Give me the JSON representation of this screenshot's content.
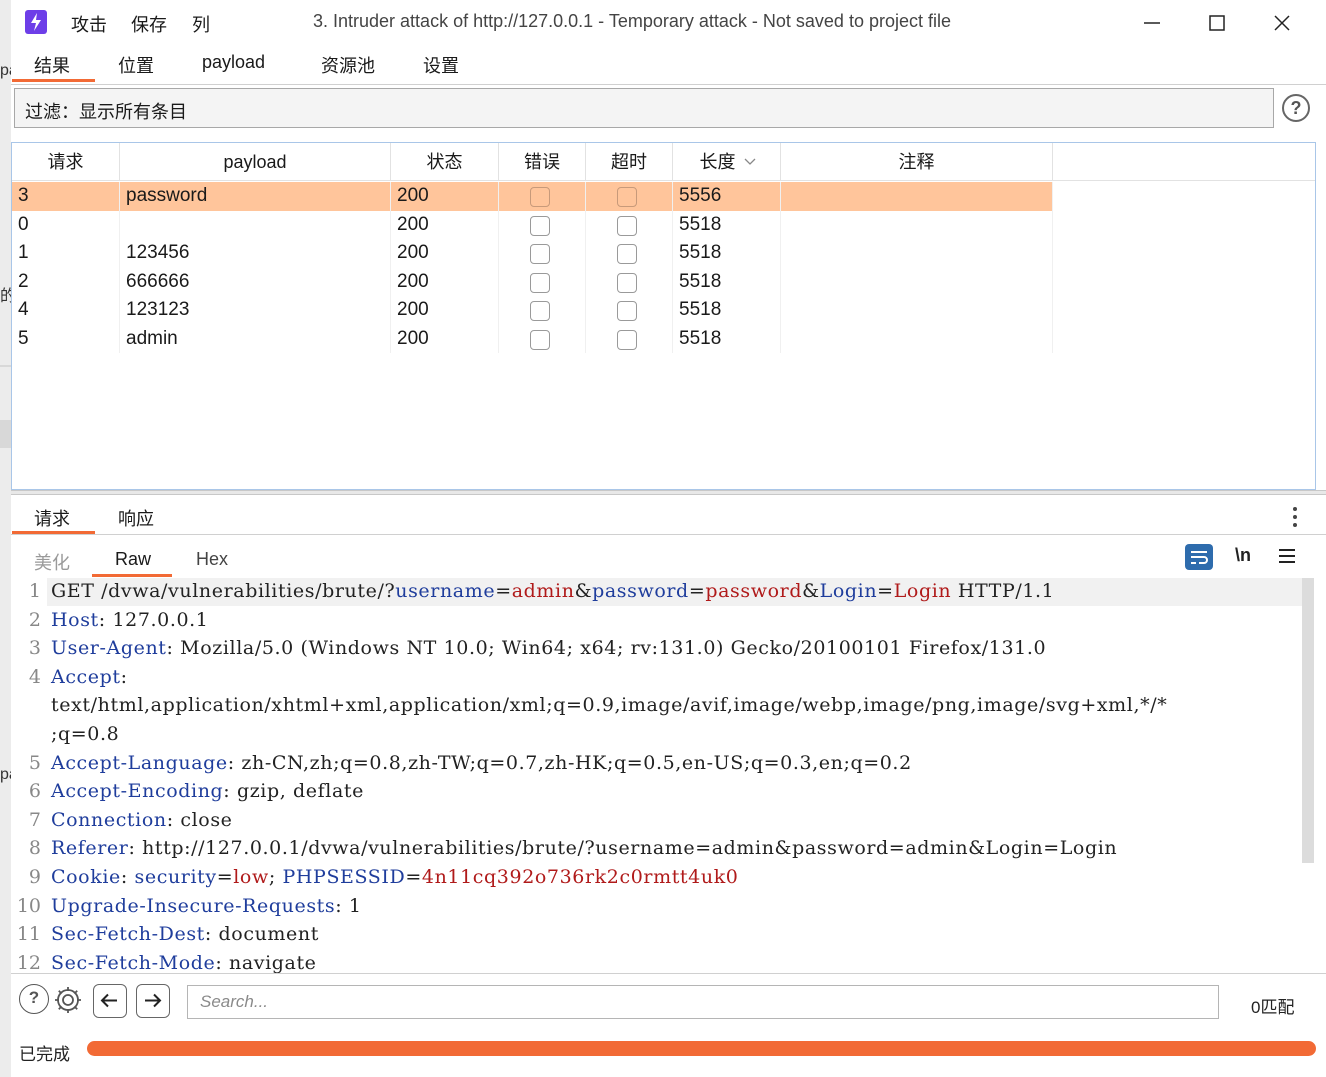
{
  "window": {
    "title": "3. Intruder attack of http://127.0.0.1 - Temporary attack - Not saved to project file",
    "menu": [
      "攻击",
      "保存",
      "列"
    ]
  },
  "left_strip_fragments": [
    "pa",
    "的",
    "pa"
  ],
  "tabs": [
    "结果",
    "位置",
    "payload",
    "资源池",
    "设置"
  ],
  "active_tab": "结果",
  "filter": {
    "text": "过滤：显示所有条目"
  },
  "results_table": {
    "columns": [
      "请求",
      "payload",
      "状态",
      "错误",
      "超时",
      "长度",
      "注释"
    ],
    "sorted_column": "长度",
    "rows": [
      {
        "request": "3",
        "payload": "password",
        "status": "200",
        "error": false,
        "timeout": false,
        "length": "5556",
        "comment": "",
        "selected": true
      },
      {
        "request": "0",
        "payload": "",
        "status": "200",
        "error": false,
        "timeout": false,
        "length": "5518",
        "comment": "",
        "selected": false
      },
      {
        "request": "1",
        "payload": "123456",
        "status": "200",
        "error": false,
        "timeout": false,
        "length": "5518",
        "comment": "",
        "selected": false
      },
      {
        "request": "2",
        "payload": "666666",
        "status": "200",
        "error": false,
        "timeout": false,
        "length": "5518",
        "comment": "",
        "selected": false
      },
      {
        "request": "4",
        "payload": "123123",
        "status": "200",
        "error": false,
        "timeout": false,
        "length": "5518",
        "comment": "",
        "selected": false
      },
      {
        "request": "5",
        "payload": "admin",
        "status": "200",
        "error": false,
        "timeout": false,
        "length": "5518",
        "comment": "",
        "selected": false
      }
    ]
  },
  "rr_tabs": [
    "请求",
    "响应"
  ],
  "view_tabs": [
    "美化",
    "Raw",
    "Hex"
  ],
  "active_view_tab": "Raw",
  "newline_label": "\\n",
  "editor": {
    "line_numbers": [
      "1",
      "2",
      "3",
      "4",
      "",
      "",
      "5",
      "6",
      "7",
      "8",
      "9",
      "10",
      "11",
      "12"
    ],
    "lines": [
      "GET /dvwa/vulnerabilities/brute/?username=admin&password=password&Login=Login HTTP/1.1",
      "Host: 127.0.0.1",
      "User-Agent: Mozilla/5.0 (Windows NT 10.0; Win64; x64; rv:131.0) Gecko/20100101 Firefox/131.0",
      "Accept:",
      "text/html,application/xhtml+xml,application/xml;q=0.9,image/avif,image/webp,image/png,image/svg+xml,*/*",
      ";q=0.8",
      "Accept-Language: zh-CN,zh;q=0.8,zh-TW;q=0.7,zh-HK;q=0.5,en-US;q=0.3,en;q=0.2",
      "Accept-Encoding: gzip, deflate",
      "Connection: close",
      "Referer: http://127.0.0.1/dvwa/vulnerabilities/brute/?username=admin&password=admin&Login=Login",
      "Cookie: security=low; PHPSESSID=4n11cq392o736rk2c0rmtt4uk0",
      "Upgrade-Insecure-Requests: 1",
      "Sec-Fetch-Dest: document",
      "Sec-Fetch-Mode: navigate"
    ]
  },
  "search": {
    "placeholder": "Search...",
    "match_count": "0匹配"
  },
  "status": {
    "text": "已完成",
    "progress": 1.0
  },
  "colors": {
    "accent": "#f26a35",
    "selected_row": "#ffc59b",
    "header_key": "#1f3d9c",
    "param_value": "#b01a1a",
    "app_icon": "#6d3ee8"
  }
}
